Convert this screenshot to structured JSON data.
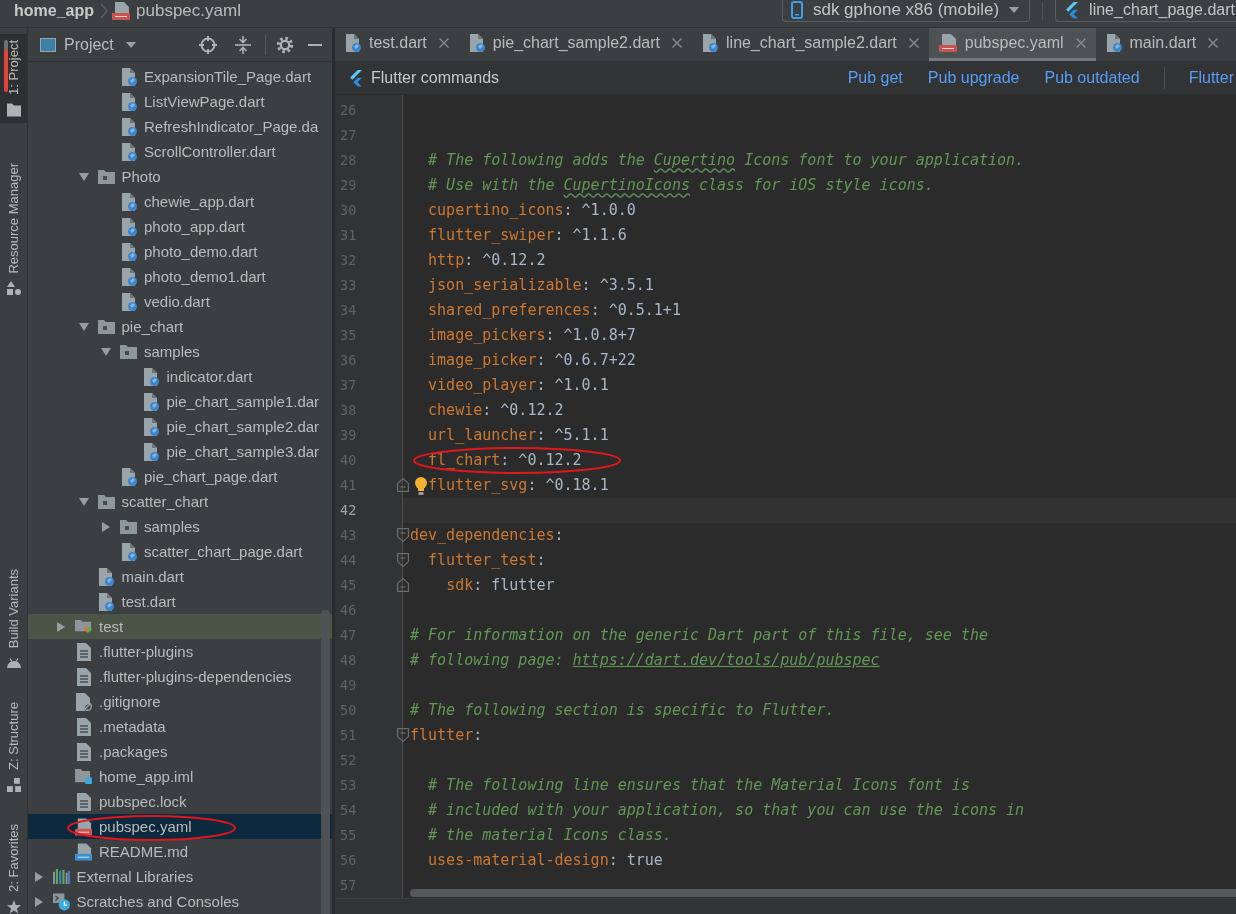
{
  "title_bar": {
    "breadcrumbs": [
      {
        "kind": "project",
        "label": "home_app"
      },
      {
        "kind": "yaml",
        "label": "pubspec.yaml"
      }
    ],
    "device": "sdk gphone x86 (mobile)",
    "run_config": "line_chart_page.dart"
  },
  "tool_strip": {
    "top": [
      {
        "label": "1: Project",
        "kind": "project",
        "selected": true,
        "marked": true
      },
      {
        "label": "Resource Manager",
        "kind": "resources",
        "selected": false,
        "marked": false
      }
    ],
    "bottom": [
      {
        "label": "Build Variants",
        "kind": "android",
        "selected": false,
        "marked": false
      },
      {
        "label": "Z: Structure",
        "kind": "structure",
        "selected": false,
        "marked": false
      },
      {
        "label": "2: Favorites",
        "kind": "favorites",
        "selected": false,
        "marked": false
      }
    ]
  },
  "project_panel": {
    "title": "Project",
    "tree": [
      {
        "children": [
          {
            "children": [
              {
                "children": [
                  {
                    "label": "ExpansionTile_Page.dart",
                    "kind": "dart",
                    "selected": false
                  },
                  {
                    "label": "ListViewPage.dart",
                    "kind": "dart",
                    "selected": false
                  },
                  {
                    "label": "RefreshIndicator_Page.da",
                    "kind": "dart",
                    "selected": false
                  },
                  {
                    "label": "ScrollController.dart",
                    "kind": "dart",
                    "selected": false
                  }
                ]
              },
              {
                "label": "Photo",
                "kind": "folder",
                "expanded": true,
                "selected": false,
                "children": [
                  {
                    "label": "chewie_app.dart",
                    "kind": "dart",
                    "selected": false
                  },
                  {
                    "label": "photo_app.dart",
                    "kind": "dart",
                    "selected": false
                  },
                  {
                    "label": "photo_demo.dart",
                    "kind": "dart",
                    "selected": false
                  },
                  {
                    "label": "photo_demo1.dart",
                    "kind": "dart",
                    "selected": false
                  },
                  {
                    "label": "vedio.dart",
                    "kind": "dart",
                    "selected": false
                  }
                ]
              },
              {
                "label": "pie_chart",
                "kind": "folder",
                "expanded": true,
                "selected": false,
                "children": [
                  {
                    "label": "samples",
                    "kind": "folder",
                    "expanded": true,
                    "selected": false,
                    "children": [
                      {
                        "label": "indicator.dart",
                        "kind": "dart",
                        "selected": false
                      },
                      {
                        "label": "pie_chart_sample1.dar",
                        "kind": "dart",
                        "selected": false
                      },
                      {
                        "label": "pie_chart_sample2.dar",
                        "kind": "dart",
                        "selected": false
                      },
                      {
                        "label": "pie_chart_sample3.dar",
                        "kind": "dart",
                        "selected": false
                      }
                    ]
                  },
                  {
                    "label": "pie_chart_page.dart",
                    "kind": "dart",
                    "selected": false
                  }
                ]
              },
              {
                "label": "scatter_chart",
                "kind": "folder",
                "expanded": true,
                "selected": false,
                "children": [
                  {
                    "label": "samples",
                    "kind": "folder",
                    "expanded": false,
                    "selected": false
                  },
                  {
                    "label": "scatter_chart_page.dart",
                    "kind": "dart",
                    "selected": false
                  }
                ]
              },
              {
                "label": "main.dart",
                "kind": "dart",
                "selected": false
              },
              {
                "label": "test.dart",
                "kind": "dart",
                "selected": false
              }
            ]
          },
          {
            "label": "test",
            "kind": "test_folder",
            "expanded": false,
            "selected": false
          },
          {
            "label": ".flutter-plugins",
            "kind": "text",
            "selected": false
          },
          {
            "label": ".flutter-plugins-dependencies",
            "kind": "text",
            "selected": false
          },
          {
            "label": ".gitignore",
            "kind": "ignore",
            "selected": false
          },
          {
            "label": ".metadata",
            "kind": "text",
            "selected": false
          },
          {
            "label": ".packages",
            "kind": "text",
            "selected": false
          },
          {
            "label": "home_app.iml",
            "kind": "module",
            "selected": false
          },
          {
            "label": "pubspec.lock",
            "kind": "text",
            "selected": false
          },
          {
            "label": "pubspec.yaml",
            "kind": "yaml",
            "selected": true,
            "circled": true
          },
          {
            "label": "README.md",
            "kind": "markdown",
            "selected": false
          }
        ]
      },
      {
        "label": "External Libraries",
        "kind": "libraries",
        "expanded": false,
        "selected": false
      },
      {
        "label": "Scratches and Consoles",
        "kind": "scratches",
        "expanded": false,
        "selected": false
      }
    ]
  },
  "editor": {
    "tabs": [
      {
        "label": "test.dart",
        "kind": "dart",
        "selected": false
      },
      {
        "label": "pie_chart_sample2.dart",
        "kind": "dart",
        "selected": false
      },
      {
        "label": "line_chart_sample2.dart",
        "kind": "dart",
        "selected": false
      },
      {
        "label": "pubspec.yaml",
        "kind": "yaml",
        "selected": true
      },
      {
        "label": "main.dart",
        "kind": "dart",
        "selected": false
      }
    ],
    "commands_bar": {
      "title": "Flutter commands",
      "actions": [
        "Pub get",
        "Pub upgrade",
        "Pub outdated"
      ],
      "trailing_action": "Flutter"
    },
    "lines": [
      {
        "number": "26",
        "current": false
      },
      {
        "number": "27",
        "current": false
      },
      {
        "number": "28",
        "current": false,
        "segments": [
          {
            "kind": "comment",
            "text": "  # The following adds the "
          },
          {
            "kind": "flagged",
            "text": "Cupertino"
          },
          {
            "kind": "comment",
            "text": " Icons font to your application."
          }
        ]
      },
      {
        "number": "29",
        "current": false,
        "segments": [
          {
            "kind": "comment",
            "text": "  # Use with the "
          },
          {
            "kind": "flagged",
            "text": "CupertinoIcons"
          },
          {
            "kind": "comment",
            "text": " class for iOS style icons."
          }
        ]
      },
      {
        "number": "30",
        "current": false,
        "segments": [
          {
            "kind": "key",
            "text": "  cupertino_icons"
          },
          {
            "kind": "plain",
            "text": ": ^1.0.0"
          }
        ]
      },
      {
        "number": "31",
        "current": false,
        "segments": [
          {
            "kind": "key",
            "text": "  flutter_swiper"
          },
          {
            "kind": "plain",
            "text": ": ^1.1.6"
          }
        ]
      },
      {
        "number": "32",
        "current": false,
        "segments": [
          {
            "kind": "key",
            "text": "  http"
          },
          {
            "kind": "plain",
            "text": ": ^0.12.2"
          }
        ]
      },
      {
        "number": "33",
        "current": false,
        "segments": [
          {
            "kind": "key",
            "text": "  json_serializable"
          },
          {
            "kind": "plain",
            "text": ": ^3.5.1"
          }
        ]
      },
      {
        "number": "34",
        "current": false,
        "segments": [
          {
            "kind": "key",
            "text": "  shared_preferences"
          },
          {
            "kind": "plain",
            "text": ": ^0.5.1+1"
          }
        ]
      },
      {
        "number": "35",
        "current": false,
        "segments": [
          {
            "kind": "key",
            "text": "  image_pickers"
          },
          {
            "kind": "plain",
            "text": ": ^1.0.8+7"
          }
        ]
      },
      {
        "number": "36",
        "current": false,
        "segments": [
          {
            "kind": "key",
            "text": "  image_picker"
          },
          {
            "kind": "plain",
            "text": ": ^0.6.7+22"
          }
        ]
      },
      {
        "number": "37",
        "current": false,
        "segments": [
          {
            "kind": "key",
            "text": "  video_player"
          },
          {
            "kind": "plain",
            "text": ": ^1.0.1"
          }
        ]
      },
      {
        "number": "38",
        "current": false,
        "segments": [
          {
            "kind": "key",
            "text": "  chewie"
          },
          {
            "kind": "plain",
            "text": ": ^0.12.2"
          }
        ]
      },
      {
        "number": "39",
        "current": false,
        "segments": [
          {
            "kind": "key",
            "text": "  url_launcher"
          },
          {
            "kind": "plain",
            "text": ": ^5.1.1"
          }
        ]
      },
      {
        "number": "40",
        "current": false,
        "circled": true,
        "segments": [
          {
            "kind": "key",
            "text": "  fl_chart"
          },
          {
            "kind": "plain",
            "text": ": ^0.12.2"
          }
        ]
      },
      {
        "number": "41",
        "current": false,
        "bulb": true,
        "fold_close": true,
        "segments": [
          {
            "kind": "key",
            "text": "  flutter_svg"
          },
          {
            "kind": "plain",
            "text": ": ^0.18.1"
          }
        ]
      },
      {
        "number": "42",
        "current": true
      },
      {
        "number": "43",
        "current": false,
        "fold_open": true,
        "segments": [
          {
            "kind": "key",
            "text": "dev_dependencies"
          },
          {
            "kind": "plain",
            "text": ":"
          }
        ]
      },
      {
        "number": "44",
        "current": false,
        "fold_open": true,
        "segments": [
          {
            "kind": "key",
            "text": "  flutter_test"
          },
          {
            "kind": "plain",
            "text": ":"
          }
        ]
      },
      {
        "number": "45",
        "current": false,
        "fold_close": true,
        "segments": [
          {
            "kind": "key",
            "text": "    sdk"
          },
          {
            "kind": "plain",
            "text": ": flutter"
          }
        ]
      },
      {
        "number": "46",
        "current": false
      },
      {
        "number": "47",
        "current": false,
        "segments": [
          {
            "kind": "comment",
            "text": "# For information on the generic Dart part of this file, see the"
          }
        ]
      },
      {
        "number": "48",
        "current": false,
        "segments": [
          {
            "kind": "comment",
            "text": "# following page: "
          },
          {
            "kind": "link",
            "text": "https://dart.dev/tools/pub/pubspec"
          }
        ]
      },
      {
        "number": "49",
        "current": false
      },
      {
        "number": "50",
        "current": false,
        "segments": [
          {
            "kind": "comment",
            "text": "# The following section is specific to Flutter."
          }
        ]
      },
      {
        "number": "51",
        "current": false,
        "fold_open": true,
        "segments": [
          {
            "kind": "key",
            "text": "flutter"
          },
          {
            "kind": "plain",
            "text": ":"
          }
        ]
      },
      {
        "number": "52",
        "current": false
      },
      {
        "number": "53",
        "current": false,
        "segments": [
          {
            "kind": "comment",
            "text": "  # The following line ensures that the Material Icons font is"
          }
        ]
      },
      {
        "number": "54",
        "current": false,
        "segments": [
          {
            "kind": "comment",
            "text": "  # included with your application, so that you can use the icons in"
          }
        ]
      },
      {
        "number": "55",
        "current": false,
        "segments": [
          {
            "kind": "comment",
            "text": "  # the material Icons class."
          }
        ]
      },
      {
        "number": "56",
        "current": false,
        "segments": [
          {
            "kind": "key",
            "text": "  uses-material-design"
          },
          {
            "kind": "plain",
            "text": ": true"
          }
        ]
      },
      {
        "number": "57",
        "current": false
      }
    ]
  }
}
